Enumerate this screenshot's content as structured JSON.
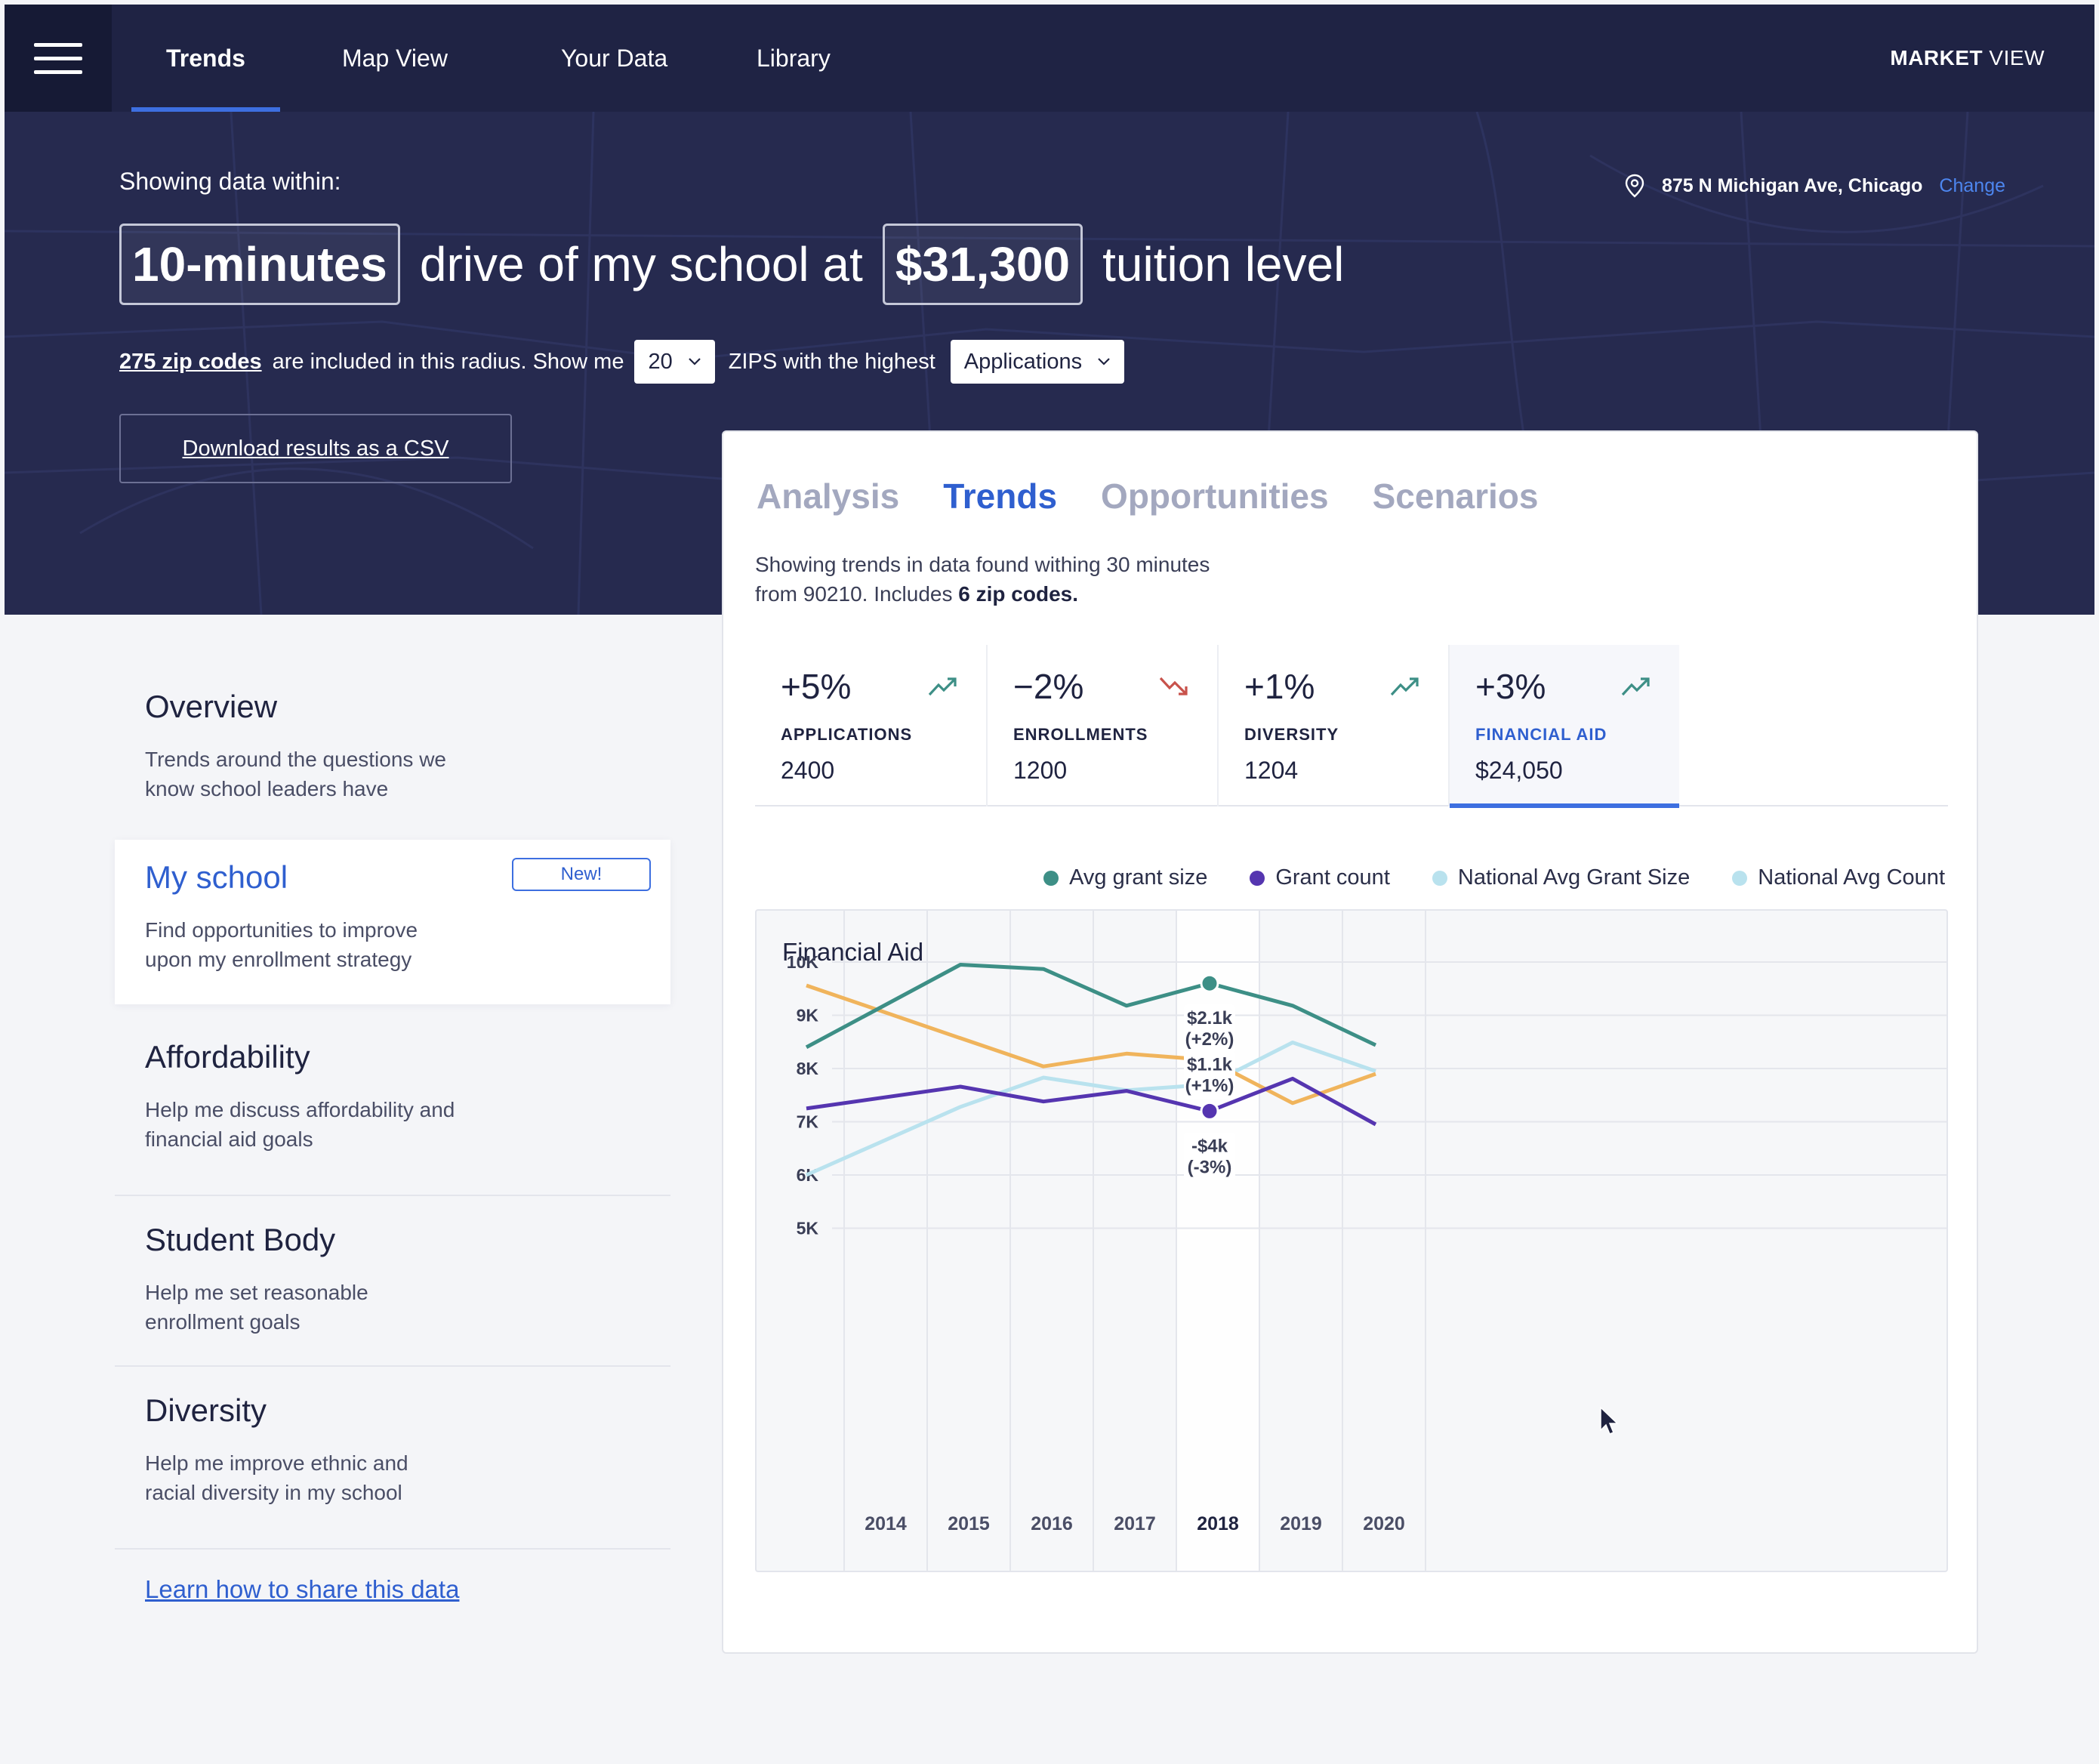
{
  "nav": {
    "tabs": [
      "Trends",
      "Map View",
      "Your Data",
      "Library"
    ],
    "brand_bold": "MARKET",
    "brand_light": " VIEW"
  },
  "hero": {
    "showing_label": "Showing data within:",
    "address": "875 N Michigan Ave, Chicago",
    "change_link": "Change",
    "drive_pill": "10-minutes",
    "drive_text": "drive of my school at",
    "tuition_pill": "$31,300",
    "tuition_text": "tuition level",
    "zip_count_link": "275 zip codes",
    "radius_text": "are included in this radius.  Show me",
    "show_count": "20",
    "zips_text": "ZIPS with the highest",
    "metric_select": "Applications",
    "csv_button": "Download results as a CSV"
  },
  "sidebar": {
    "items": [
      {
        "title": "Overview",
        "desc": "Trends around the questions we know school leaders have"
      },
      {
        "title": "My school",
        "desc": "Find opportunities to improve upon my enrollment strategy",
        "badge": "New!"
      },
      {
        "title": "Affordability",
        "desc": "Help me discuss affordability and financial aid goals"
      },
      {
        "title": "Student Body",
        "desc": "Help me set reasonable enrollment goals"
      },
      {
        "title": "Diversity",
        "desc": "Help me improve ethnic and racial diversity in my school"
      }
    ],
    "learn_link": "Learn how to share this data"
  },
  "card": {
    "tabs": [
      "Analysis",
      "Trends",
      "Opportunities",
      "Scenarios"
    ],
    "active_tab": "Trends",
    "desc_prefix": "Showing trends in data found withing 30 minutes from 90210. Includes ",
    "desc_bold": "6 zip codes.",
    "metrics": [
      {
        "change": "+5%",
        "label": "APPLICATIONS",
        "value": "2400",
        "trend": "up"
      },
      {
        "change": "−2%",
        "label": "ENROLLMENTS",
        "value": "1200",
        "trend": "down"
      },
      {
        "change": "+1%",
        "label": "DIVERSITY",
        "value": "1204",
        "trend": "up"
      },
      {
        "change": "+3%",
        "label": "FINANCIAL AID",
        "value": "$24,050",
        "trend": "up"
      }
    ],
    "icons": {
      "up": "trend-up-icon",
      "down": "trend-down-icon",
      "pin": "location-pin-icon",
      "menu": "menu-icon"
    }
  },
  "chart_data": {
    "type": "line",
    "title": "Financial Aid",
    "xlabel": "",
    "ylabel": "",
    "x": [
      "2014",
      "2015",
      "2016",
      "2017",
      "2018",
      "2019",
      "2020"
    ],
    "ylim": [
      5000,
      10000
    ],
    "yticks": [
      "10K",
      "9K",
      "8K",
      "7K",
      "6K",
      "5K"
    ],
    "grid": true,
    "legend_position": "top-right",
    "highlight_x": "2018",
    "series": [
      {
        "name": "Avg grant size",
        "color": "#3d8f86",
        "points": [
          [
            2013.5,
            8400
          ],
          [
            2014.5,
            9950
          ],
          [
            2015.5,
            9870
          ],
          [
            2016.5,
            9180
          ],
          [
            2017.5,
            9600
          ],
          [
            2018.5,
            9180
          ],
          [
            2019.5,
            8440
          ]
        ]
      },
      {
        "name": "Grant count",
        "color": "#5535b0",
        "points": [
          [
            2013.5,
            7250
          ],
          [
            2014.5,
            7660
          ],
          [
            2015.5,
            7380
          ],
          [
            2016.5,
            7580
          ],
          [
            2017.5,
            7200
          ],
          [
            2018.5,
            7810
          ],
          [
            2019.5,
            6950
          ]
        ]
      },
      {
        "name": "National Avg Grant Size",
        "color": "#b9e2ee",
        "points": [
          [
            2013.5,
            6000
          ],
          [
            2014.5,
            7280
          ],
          [
            2015.5,
            7830
          ],
          [
            2016.5,
            7590
          ],
          [
            2017.5,
            7700
          ],
          [
            2018.5,
            8490
          ],
          [
            2019.5,
            7950
          ]
        ]
      },
      {
        "name": "National Avg Count",
        "color": "#b9e2ee",
        "points": []
      },
      {
        "name": "",
        "color": "#f0b45c",
        "points": [
          [
            2013.5,
            9560
          ],
          [
            2014.5,
            8570
          ],
          [
            2015.5,
            8040
          ],
          [
            2016.5,
            8280
          ],
          [
            2017.5,
            8160
          ],
          [
            2018.5,
            7350
          ],
          [
            2019.5,
            7900
          ]
        ]
      }
    ],
    "annotations": [
      {
        "series": "Avg grant size",
        "x": 2017.5,
        "y": 9600,
        "line1": "$2.1k",
        "line2": "(+2%)"
      },
      {
        "series": "",
        "x": 2017.5,
        "y": 8160,
        "line1": "$1.1k",
        "line2": "(+1%)"
      },
      {
        "series": "Grant count",
        "x": 2017.5,
        "y": 7200,
        "line1": "-$4k",
        "line2": "(-3%)"
      }
    ]
  }
}
